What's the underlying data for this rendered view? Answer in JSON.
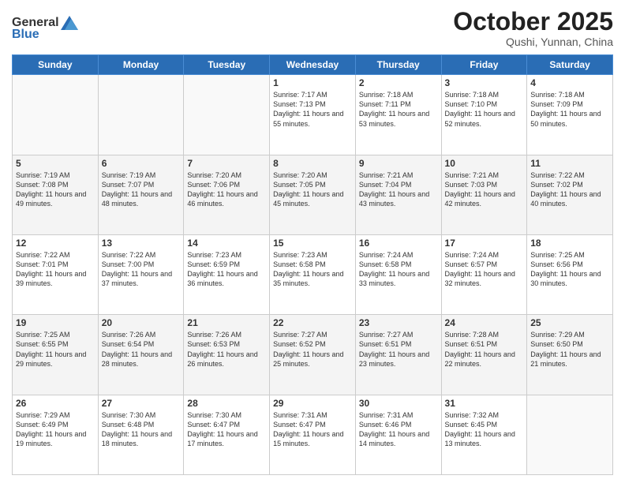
{
  "header": {
    "logo_general": "General",
    "logo_blue": "Blue",
    "month": "October 2025",
    "location": "Qushi, Yunnan, China"
  },
  "days_of_week": [
    "Sunday",
    "Monday",
    "Tuesday",
    "Wednesday",
    "Thursday",
    "Friday",
    "Saturday"
  ],
  "weeks": [
    [
      {
        "day": "",
        "text": ""
      },
      {
        "day": "",
        "text": ""
      },
      {
        "day": "",
        "text": ""
      },
      {
        "day": "1",
        "text": "Sunrise: 7:17 AM\nSunset: 7:13 PM\nDaylight: 11 hours\nand 55 minutes."
      },
      {
        "day": "2",
        "text": "Sunrise: 7:18 AM\nSunset: 7:11 PM\nDaylight: 11 hours\nand 53 minutes."
      },
      {
        "day": "3",
        "text": "Sunrise: 7:18 AM\nSunset: 7:10 PM\nDaylight: 11 hours\nand 52 minutes."
      },
      {
        "day": "4",
        "text": "Sunrise: 7:18 AM\nSunset: 7:09 PM\nDaylight: 11 hours\nand 50 minutes."
      }
    ],
    [
      {
        "day": "5",
        "text": "Sunrise: 7:19 AM\nSunset: 7:08 PM\nDaylight: 11 hours\nand 49 minutes."
      },
      {
        "day": "6",
        "text": "Sunrise: 7:19 AM\nSunset: 7:07 PM\nDaylight: 11 hours\nand 48 minutes."
      },
      {
        "day": "7",
        "text": "Sunrise: 7:20 AM\nSunset: 7:06 PM\nDaylight: 11 hours\nand 46 minutes."
      },
      {
        "day": "8",
        "text": "Sunrise: 7:20 AM\nSunset: 7:05 PM\nDaylight: 11 hours\nand 45 minutes."
      },
      {
        "day": "9",
        "text": "Sunrise: 7:21 AM\nSunset: 7:04 PM\nDaylight: 11 hours\nand 43 minutes."
      },
      {
        "day": "10",
        "text": "Sunrise: 7:21 AM\nSunset: 7:03 PM\nDaylight: 11 hours\nand 42 minutes."
      },
      {
        "day": "11",
        "text": "Sunrise: 7:22 AM\nSunset: 7:02 PM\nDaylight: 11 hours\nand 40 minutes."
      }
    ],
    [
      {
        "day": "12",
        "text": "Sunrise: 7:22 AM\nSunset: 7:01 PM\nDaylight: 11 hours\nand 39 minutes."
      },
      {
        "day": "13",
        "text": "Sunrise: 7:22 AM\nSunset: 7:00 PM\nDaylight: 11 hours\nand 37 minutes."
      },
      {
        "day": "14",
        "text": "Sunrise: 7:23 AM\nSunset: 6:59 PM\nDaylight: 11 hours\nand 36 minutes."
      },
      {
        "day": "15",
        "text": "Sunrise: 7:23 AM\nSunset: 6:58 PM\nDaylight: 11 hours\nand 35 minutes."
      },
      {
        "day": "16",
        "text": "Sunrise: 7:24 AM\nSunset: 6:58 PM\nDaylight: 11 hours\nand 33 minutes."
      },
      {
        "day": "17",
        "text": "Sunrise: 7:24 AM\nSunset: 6:57 PM\nDaylight: 11 hours\nand 32 minutes."
      },
      {
        "day": "18",
        "text": "Sunrise: 7:25 AM\nSunset: 6:56 PM\nDaylight: 11 hours\nand 30 minutes."
      }
    ],
    [
      {
        "day": "19",
        "text": "Sunrise: 7:25 AM\nSunset: 6:55 PM\nDaylight: 11 hours\nand 29 minutes."
      },
      {
        "day": "20",
        "text": "Sunrise: 7:26 AM\nSunset: 6:54 PM\nDaylight: 11 hours\nand 28 minutes."
      },
      {
        "day": "21",
        "text": "Sunrise: 7:26 AM\nSunset: 6:53 PM\nDaylight: 11 hours\nand 26 minutes."
      },
      {
        "day": "22",
        "text": "Sunrise: 7:27 AM\nSunset: 6:52 PM\nDaylight: 11 hours\nand 25 minutes."
      },
      {
        "day": "23",
        "text": "Sunrise: 7:27 AM\nSunset: 6:51 PM\nDaylight: 11 hours\nand 23 minutes."
      },
      {
        "day": "24",
        "text": "Sunrise: 7:28 AM\nSunset: 6:51 PM\nDaylight: 11 hours\nand 22 minutes."
      },
      {
        "day": "25",
        "text": "Sunrise: 7:29 AM\nSunset: 6:50 PM\nDaylight: 11 hours\nand 21 minutes."
      }
    ],
    [
      {
        "day": "26",
        "text": "Sunrise: 7:29 AM\nSunset: 6:49 PM\nDaylight: 11 hours\nand 19 minutes."
      },
      {
        "day": "27",
        "text": "Sunrise: 7:30 AM\nSunset: 6:48 PM\nDaylight: 11 hours\nand 18 minutes."
      },
      {
        "day": "28",
        "text": "Sunrise: 7:30 AM\nSunset: 6:47 PM\nDaylight: 11 hours\nand 17 minutes."
      },
      {
        "day": "29",
        "text": "Sunrise: 7:31 AM\nSunset: 6:47 PM\nDaylight: 11 hours\nand 15 minutes."
      },
      {
        "day": "30",
        "text": "Sunrise: 7:31 AM\nSunset: 6:46 PM\nDaylight: 11 hours\nand 14 minutes."
      },
      {
        "day": "31",
        "text": "Sunrise: 7:32 AM\nSunset: 6:45 PM\nDaylight: 11 hours\nand 13 minutes."
      },
      {
        "day": "",
        "text": ""
      }
    ]
  ]
}
